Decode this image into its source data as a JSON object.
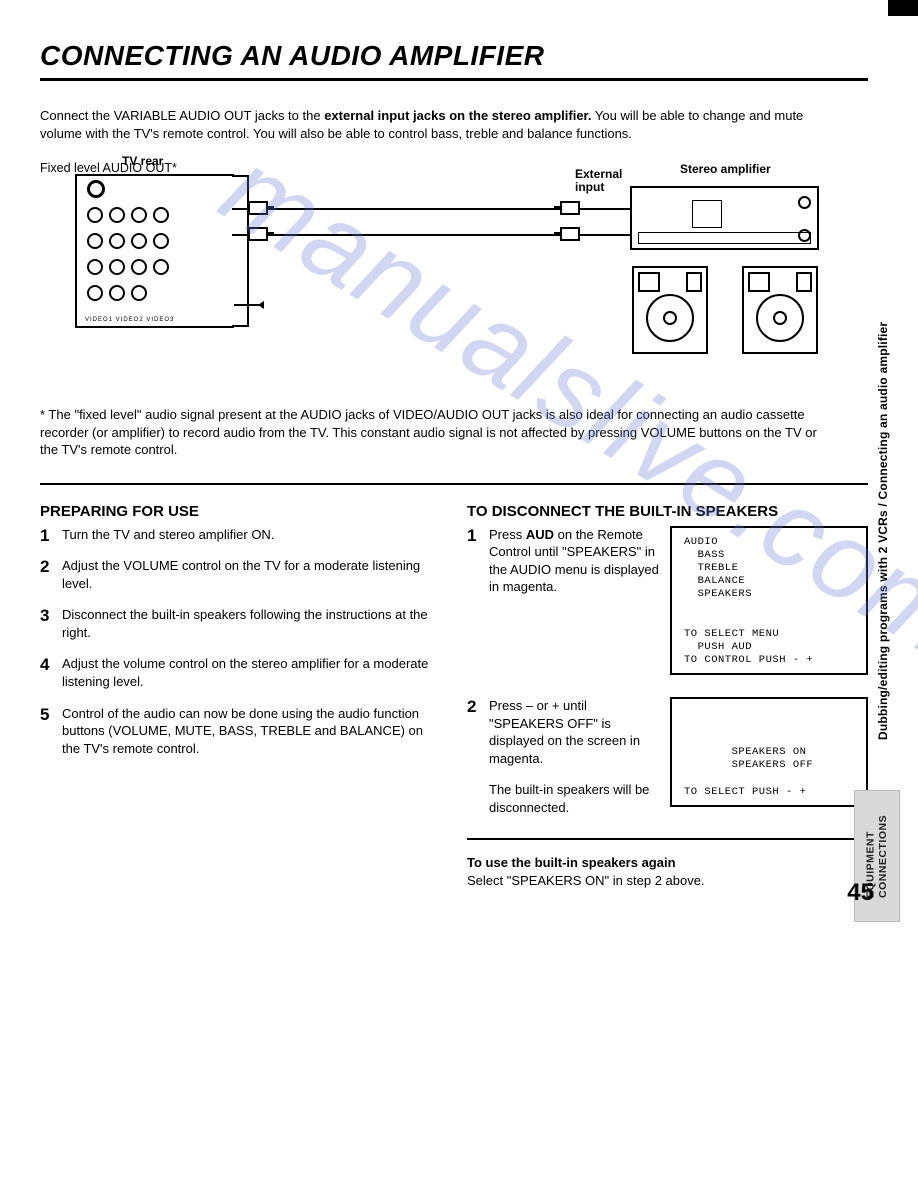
{
  "title": "CONNECTING AN AUDIO AMPLIFIER",
  "intro_parts": {
    "a": "Connect the VARIABLE AUDIO OUT jacks to the ",
    "b": "external input jacks on the stereo amplifier.",
    "c": " You will be able to change and mute volume with the TV's remote control. You will also be able to control bass, treble and balance functions."
  },
  "diagram": {
    "tv_rear": "TV rear",
    "external_input": "External\ninput",
    "stereo_amp": "Stereo amplifier",
    "fixed_out": "Fixed level AUDIO OUT*",
    "panel_text": "VIDEO1  VIDEO2  VIDEO3"
  },
  "footnote": "*   The \"fixed level\" audio signal present at the AUDIO jacks of VIDEO/AUDIO OUT jacks is also ideal for connecting an audio cassette recorder (or amplifier) to record audio from the TV. This constant audio signal is not affected by pressing VOLUME buttons on the TV or the TV's remote control.",
  "left": {
    "heading": "PREPARING FOR USE",
    "steps": [
      "Turn the TV and stereo amplifier ON.",
      "Adjust the VOLUME control on the TV for a moderate listening level.",
      "Disconnect the built-in speakers following the instructions at the right.",
      "Adjust the volume control on the stereo amplifier for a moderate listening level.",
      "Control of the audio can now be done using the audio function buttons (VOLUME, MUTE, BASS, TREBLE and BALANCE) on the TV's remote control."
    ]
  },
  "right": {
    "heading": "TO DISCONNECT THE BUILT-IN SPEAKERS",
    "step1": {
      "num": "1",
      "a": "Press ",
      "b": "AUD",
      "c": " on the Remote Control until \"SPEAKERS\" in the AUDIO menu is displayed in magenta."
    },
    "screen1": "AUDIO\n  BASS\n  TREBLE\n  BALANCE\n  SPEAKERS\n\n\nTO SELECT MENU\n  PUSH AUD\nTO CONTROL PUSH - +",
    "step2": {
      "num": "2",
      "a": "Press – or + until \"SPEAKERS OFF\" is displayed on the screen in magenta.",
      "b": "The built-in speakers will be disconnected."
    },
    "screen2": "\n\n\n       SPEAKERS ON\n       SPEAKERS OFF\n\nTO SELECT PUSH - +",
    "again_h": "To use the built-in speakers again",
    "again_b": "Select \"SPEAKERS ON\" in step 2 above."
  },
  "vside": "Dubbing/editing programs with 2 VCRs / Connecting an audio amplifier",
  "tab": "EQUIPMENT\nCONNECTIONS",
  "page": "45",
  "watermark": "manualslive.com"
}
